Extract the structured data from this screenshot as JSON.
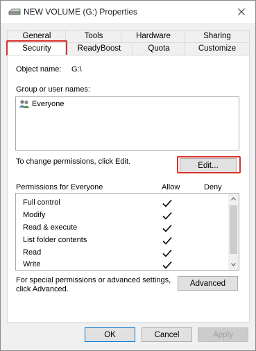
{
  "window": {
    "title": "NEW VOLUME (G:) Properties"
  },
  "tabs_row1": [
    {
      "label": "General"
    },
    {
      "label": "Tools"
    },
    {
      "label": "Hardware"
    },
    {
      "label": "Sharing"
    }
  ],
  "tabs_row2": [
    {
      "label": "Security",
      "active": true
    },
    {
      "label": "ReadyBoost"
    },
    {
      "label": "Quota"
    },
    {
      "label": "Customize"
    }
  ],
  "security": {
    "object_name_label": "Object name:",
    "object_name_value": "G:\\",
    "group_label": "Group or user names:",
    "users": [
      {
        "name": "Everyone",
        "icon": "users-icon"
      }
    ],
    "change_text": "To change permissions, click Edit.",
    "edit_button": "Edit...",
    "permissions_label": "Permissions for Everyone",
    "allow_header": "Allow",
    "deny_header": "Deny",
    "permissions": [
      {
        "name": "Full control",
        "allow": true,
        "deny": false
      },
      {
        "name": "Modify",
        "allow": true,
        "deny": false
      },
      {
        "name": "Read & execute",
        "allow": true,
        "deny": false
      },
      {
        "name": "List folder contents",
        "allow": true,
        "deny": false
      },
      {
        "name": "Read",
        "allow": true,
        "deny": false
      },
      {
        "name": "Write",
        "allow": true,
        "deny": false
      }
    ],
    "special_text_line1": "For special permissions or advanced settings,",
    "special_text_line2": "click Advanced.",
    "advanced_button": "Advanced"
  },
  "footer": {
    "ok": "OK",
    "cancel": "Cancel",
    "apply": "Apply"
  },
  "colors": {
    "highlight_red": "#d9312b",
    "default_button_border": "#0078d7"
  }
}
